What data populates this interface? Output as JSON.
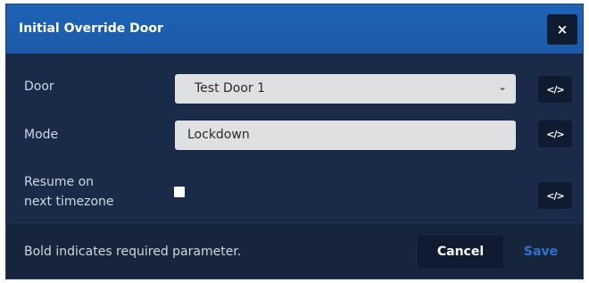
{
  "dialog": {
    "title": "Initial Override Door",
    "close_icon": "×"
  },
  "fields": {
    "door": {
      "label": "Door",
      "value": "Test Door 1",
      "chevron": "⌄"
    },
    "mode": {
      "label": "Mode",
      "value": "Lockdown"
    },
    "resume": {
      "label_line1": "Resume on",
      "label_line2": "next timezone",
      "checked": false
    }
  },
  "code_button_label": "</>",
  "footer": {
    "note": "Bold indicates required parameter.",
    "cancel_label": "Cancel",
    "save_label": "Save"
  },
  "colors": {
    "header": "#1d63b6",
    "body": "#1a2b49",
    "footer": "#17253c",
    "save_text": "#2f72d2"
  }
}
